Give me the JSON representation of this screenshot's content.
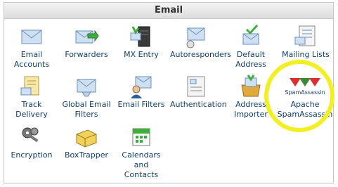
{
  "panel": {
    "title": "Email"
  },
  "items": [
    {
      "label_1": "Email",
      "label_2": "Accounts",
      "icon": "envelope-icon"
    },
    {
      "label_1": "Forwarders",
      "icon": "forward-envelope-icon"
    },
    {
      "label_1": "MX Entry",
      "icon": "server-icon"
    },
    {
      "label_1": "Autoresponders",
      "icon": "autoresponder-icon"
    },
    {
      "label_1": "Default",
      "label_2": "Address",
      "icon": "default-address-icon"
    },
    {
      "label_1": "Mailing Lists",
      "icon": "mailing-list-icon"
    },
    {
      "label_1": "Track",
      "label_2": "Delivery",
      "icon": "track-delivery-icon"
    },
    {
      "label_1": "Global Email",
      "label_2": "Filters",
      "icon": "global-filter-icon"
    },
    {
      "label_1": "Email Filters",
      "icon": "user-filter-icon"
    },
    {
      "label_1": "Authentication",
      "icon": "authentication-icon"
    },
    {
      "label_1": "Address",
      "label_2": "Importer",
      "icon": "address-importer-icon"
    },
    {
      "label_1": "Apache",
      "label_2": "SpamAssassin",
      "logo_text": "SpamAssassin",
      "icon": "spamassassin-logo"
    },
    {
      "label_1": "Encryption",
      "icon": "keys-icon"
    },
    {
      "label_1": "BoxTrapper",
      "icon": "boxtrapper-icon"
    },
    {
      "label_1": "Calendars",
      "label_2": "and",
      "label_3": "Contacts",
      "icon": "calendar-icon"
    }
  ],
  "colors": {
    "highlight": "#f3ef25",
    "label": "#123e6e"
  }
}
